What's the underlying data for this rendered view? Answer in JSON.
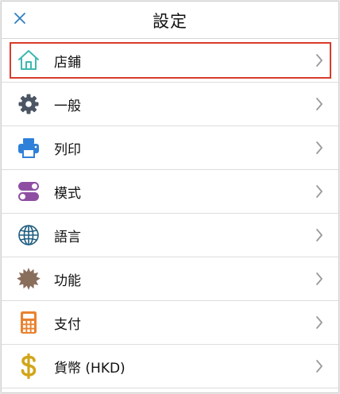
{
  "header": {
    "title": "設定",
    "close_color": "#2f7fc1"
  },
  "settings": {
    "items": [
      {
        "label": "店鋪",
        "icon": "store-icon",
        "color": "#3fb9b0",
        "selected": true
      },
      {
        "label": "一般",
        "icon": "gear-icon",
        "color": "#4b5563"
      },
      {
        "label": "列印",
        "icon": "printer-icon",
        "color": "#2f80d8"
      },
      {
        "label": "模式",
        "icon": "toggle-icon",
        "color": "#8e4fa3"
      },
      {
        "label": "語言",
        "icon": "globe-icon",
        "color": "#1f5d80"
      },
      {
        "label": "功能",
        "icon": "badge-icon",
        "color": "#8a6e5c"
      },
      {
        "label": "支付",
        "icon": "calculator-icon",
        "color": "#e9822f"
      },
      {
        "label": "貨幣 (HKD)",
        "icon": "dollar-icon",
        "color": "#d2a61b"
      }
    ]
  },
  "colors": {
    "selection_outline": "#d93b2b",
    "chevron": "#9a9a9a"
  }
}
